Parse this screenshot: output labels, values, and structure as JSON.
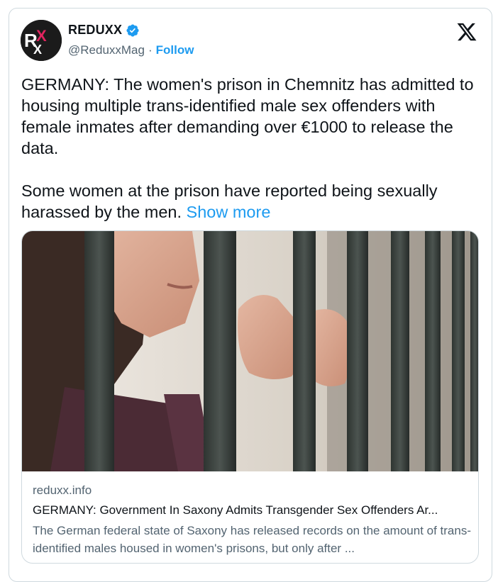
{
  "account": {
    "avatar_text": "RXX",
    "name": "REDUXX",
    "handle": "@ReduxxMag",
    "separator": "·",
    "follow_label": "Follow"
  },
  "tweet": {
    "text": "GERMANY: The women's prison in Chemnitz has admitted to housing multiple trans-identified male sex offenders with female inmates after demanding over €1000 to release the data.\n\nSome women at the prison have reported being sexually harassed by the men. ",
    "show_more": "Show more"
  },
  "link_card": {
    "domain": "reduxx.info",
    "title": "GERMANY: Government In Saxony Admits Transgender Sex Offenders Ar...",
    "description": "The German federal state of Saxony has released records on the amount of trans-identified males housed in women's prisons, but only after ..."
  },
  "colors": {
    "accent": "#1d9bf0",
    "secondary_text": "#536471",
    "border": "#cfd9de"
  },
  "icons": [
    "verified-badge-icon",
    "x-logo-icon"
  ]
}
